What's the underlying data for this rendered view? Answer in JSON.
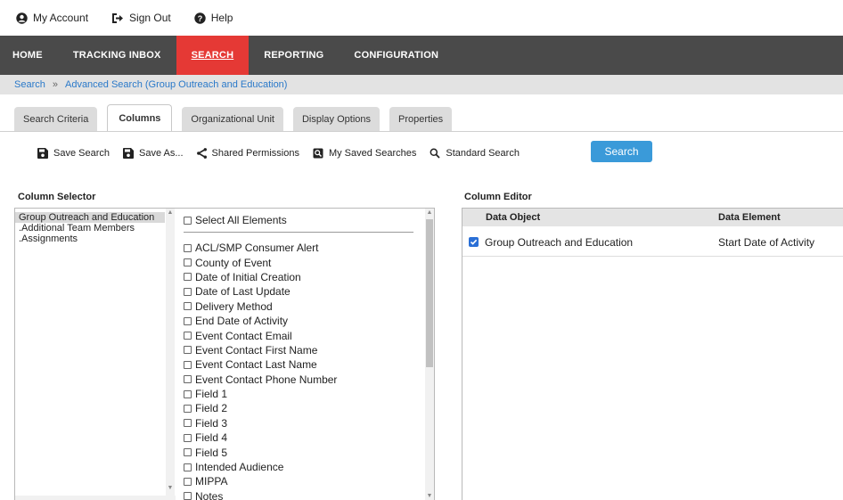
{
  "util": {
    "my_account": "My Account",
    "sign_out": "Sign Out",
    "help": "Help"
  },
  "nav": {
    "items": [
      {
        "label": "HOME"
      },
      {
        "label": "TRACKING INBOX"
      },
      {
        "label": "SEARCH",
        "active": true
      },
      {
        "label": "REPORTING"
      },
      {
        "label": "CONFIGURATION"
      }
    ],
    "bg_color": "#4a4a4a",
    "active_color": "#e53935"
  },
  "breadcrumb": {
    "root": "Search",
    "separator": "»",
    "current": "Advanced Search (Group Outreach and Education)"
  },
  "tabs": [
    {
      "label": "Search Criteria"
    },
    {
      "label": "Columns",
      "active": true
    },
    {
      "label": "Organizational Unit"
    },
    {
      "label": "Display Options"
    },
    {
      "label": "Properties"
    }
  ],
  "toolbar": {
    "save_search": "Save Search",
    "save_as": "Save As...",
    "shared_permissions": "Shared Permissions",
    "my_saved_searches": "My Saved Searches",
    "standard_search": "Standard Search",
    "search_button": "Search"
  },
  "column_selector": {
    "title": "Column Selector",
    "objects": [
      {
        "label": "Group Outreach and Education",
        "selected": true
      },
      {
        "label": ".Additional Team Members"
      },
      {
        "label": ".Assignments"
      }
    ],
    "select_all": "Select All Elements",
    "elements": [
      "ACL/SMP Consumer Alert",
      "County of Event",
      "Date of Initial Creation",
      "Date of Last Update",
      "Delivery Method",
      "End Date of Activity",
      "Event Contact Email",
      "Event Contact First Name",
      "Event Contact Last Name",
      "Event Contact Phone Number",
      "Field 1",
      "Field 2",
      "Field 3",
      "Field 4",
      "Field 5",
      "Intended Audience",
      "MIPPA",
      "Notes"
    ]
  },
  "column_editor": {
    "title": "Column Editor",
    "headers": {
      "data_object": "Data Object",
      "data_element": "Data Element"
    },
    "rows": [
      {
        "checked": true,
        "data_object": "Group Outreach and Education",
        "data_element": "Start Date of Activity"
      }
    ]
  },
  "colors": {
    "accent_blue": "#3a9ad9",
    "link_blue": "#2a79c9",
    "checkbox_blue": "#2a6fd6"
  },
  "icons": [
    "account-circle-icon",
    "sign-out-icon",
    "help-icon",
    "save-icon",
    "save-as-icon",
    "share-icon",
    "saved-searches-icon",
    "search-icon"
  ]
}
